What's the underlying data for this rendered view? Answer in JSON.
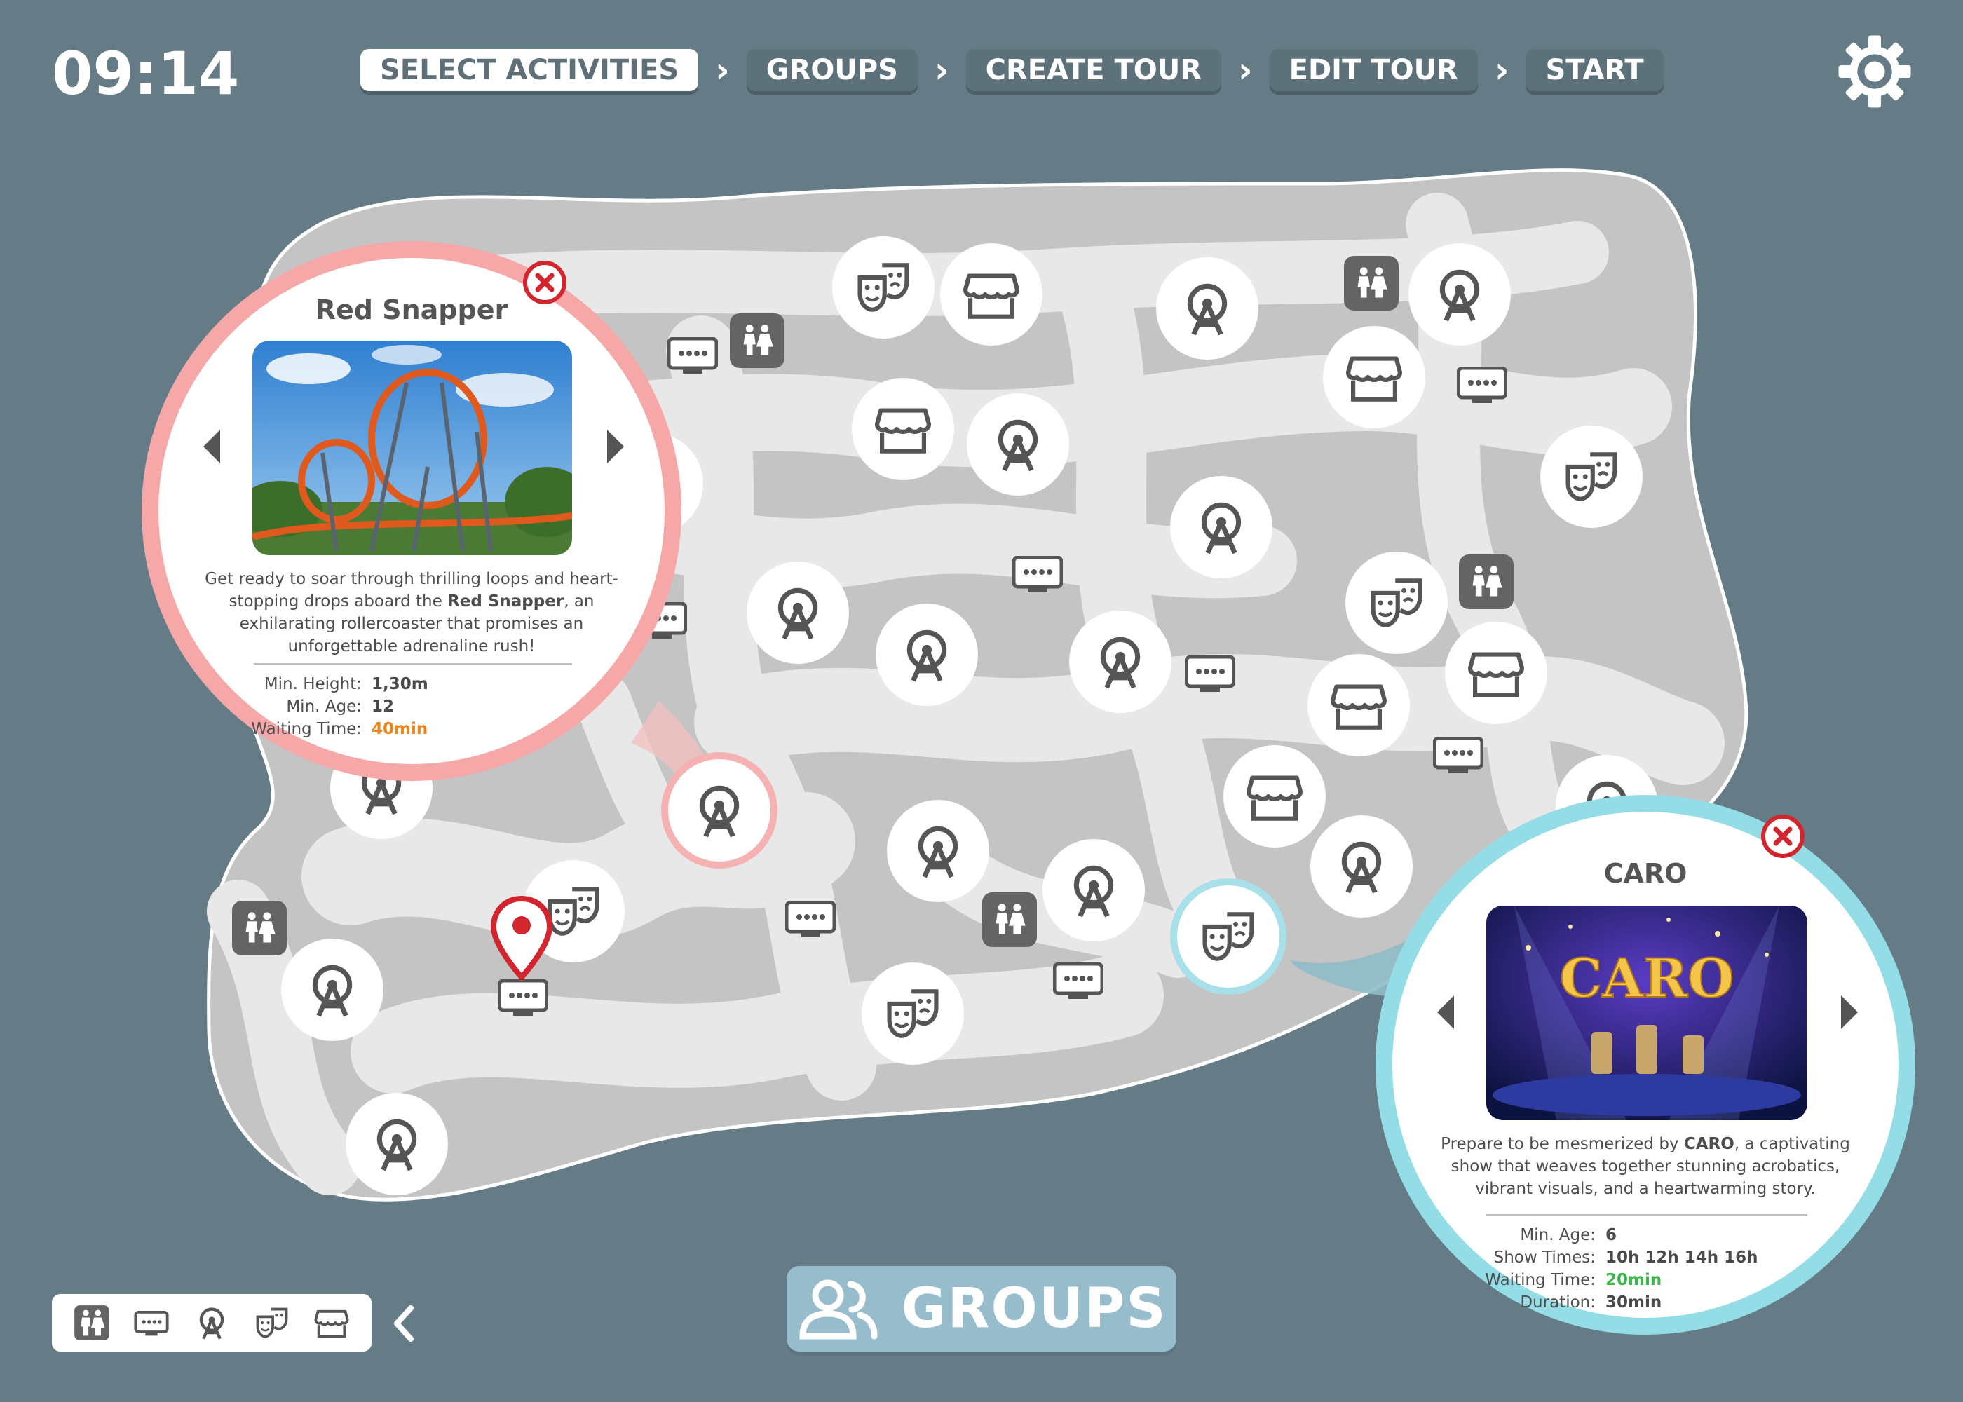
{
  "clock": "09:14",
  "steps": [
    {
      "label": "SELECT ACTIVITIES",
      "active": true
    },
    {
      "label": "GROUPS",
      "active": false
    },
    {
      "label": "CREATE TOUR",
      "active": false
    },
    {
      "label": "EDIT TOUR",
      "active": false
    },
    {
      "label": "START",
      "active": false
    }
  ],
  "settings_icon": "gear-icon",
  "colors": {
    "background": "#657c87",
    "map_dark": "#c4c4c4",
    "map_light": "#e8e8e8",
    "red_accent": "#f6a8a8",
    "teal_accent": "#94dde6",
    "close_red": "#d3252d",
    "waiting_orange": "#e8871e",
    "waiting_green": "#3cb54a",
    "groups_button": "#97bccc"
  },
  "red_card": {
    "title": "Red Snapper",
    "image": "rollercoaster-photo",
    "desc_1": "Get ready to soar through thrilling loops and heart-",
    "desc_2a": "stopping drops aboard the ",
    "desc_2b": "Red Snapper",
    "desc_2c": ", an",
    "desc_3": "exhilarating rollercoaster that promises an",
    "desc_4": "unforgettable adrenaline rush!",
    "details": [
      {
        "label": "Min. Height:",
        "value": "1,30m"
      },
      {
        "label": "Min. Age:",
        "value": "12"
      },
      {
        "label": "Waiting Time:",
        "value": "40min"
      }
    ]
  },
  "teal_card": {
    "title": "CARO",
    "image": "caro-show-photo",
    "image_text": "CARO",
    "desc_1a": "Prepare to be mesmerized by ",
    "desc_1b": "CARO",
    "desc_1c": ", a captivating",
    "desc_2": "show that weaves together stunning acrobatics,",
    "desc_3": "vibrant visuals, and a heartwarming story.",
    "details": [
      {
        "label": "Min. Age:",
        "value": "6"
      },
      {
        "label": "Show Times:",
        "value": "10h 12h 14h 16h"
      },
      {
        "label": "Waiting Time:",
        "value": "20min"
      },
      {
        "label": "Duration:",
        "value": "30min"
      }
    ]
  },
  "legend": [
    "restroom-icon",
    "food-stand-icon",
    "ride-icon",
    "show-icon",
    "shop-icon"
  ],
  "groups_button": {
    "label": "GROUPS",
    "icon": "group-icon"
  }
}
